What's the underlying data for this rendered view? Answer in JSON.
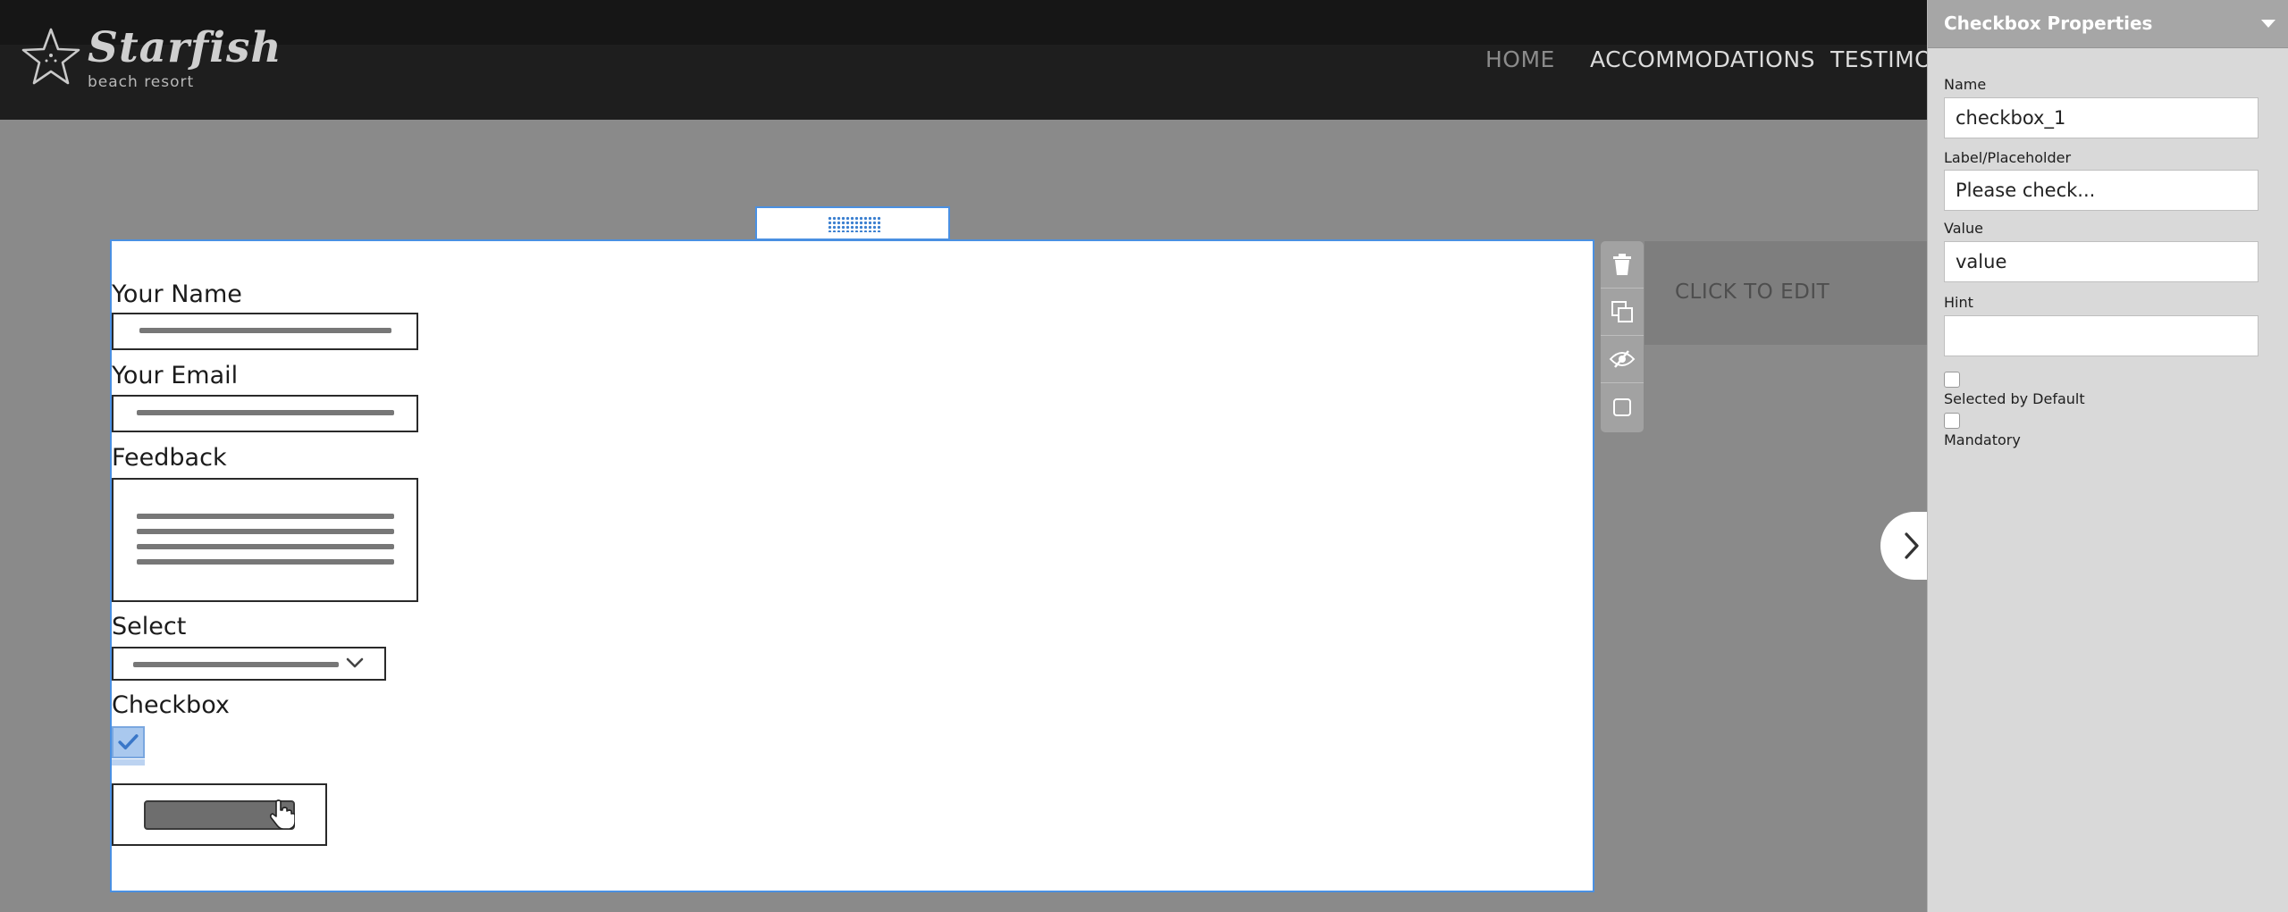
{
  "header": {
    "logo_name": "Starfish",
    "logo_sub": "beach resort",
    "nav": [
      "HOME",
      "ACCOMMODATIONS",
      "TESTIMON"
    ]
  },
  "placeholder_section": {
    "label": "CLICK TO EDIT"
  },
  "form": {
    "fields": {
      "name_label": "Your Name",
      "email_label": "Your Email",
      "feedback_label": "Feedback",
      "select_label": "Select",
      "checkbox_label": "Checkbox"
    },
    "toolbar_icons": [
      "trash-icon",
      "duplicate-icon",
      "visibility-icon",
      "square-icon"
    ]
  },
  "panel": {
    "title": "Checkbox Properties",
    "name_label": "Name",
    "name_value": "checkbox_1",
    "label_label": "Label/Placeholder",
    "label_value": "Please check...",
    "value_label": "Value",
    "value_value": "value",
    "hint_label": "Hint",
    "hint_value": "",
    "selected_label": "Selected by Default",
    "mandatory_label": "Mandatory"
  },
  "colors": {
    "accent": "#4a90e2",
    "header_bg": "#1e1e1e",
    "canvas_bg": "#8a8a8a",
    "panel_bg": "#d9d9d9"
  }
}
